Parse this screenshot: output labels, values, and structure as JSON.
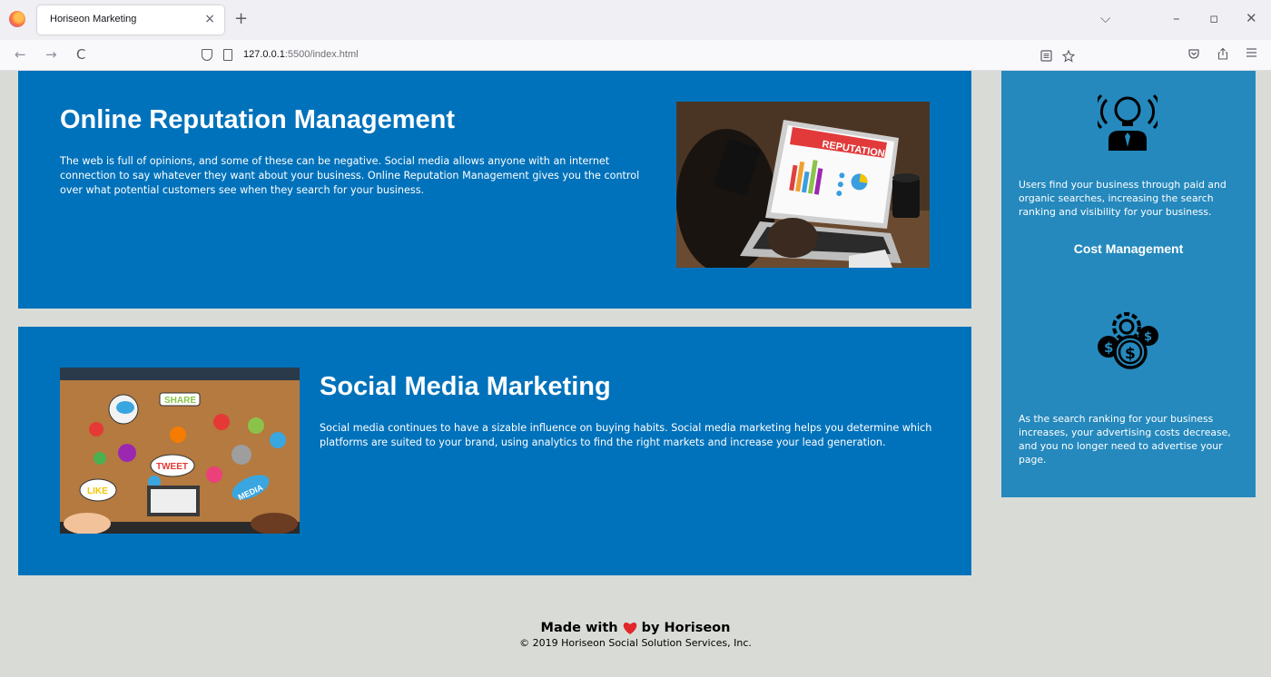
{
  "browser": {
    "tab_title": "Horiseon Marketing",
    "tab_close": "×",
    "new_tab": "+",
    "url_host": "127.0.0.1",
    "url_rest": ":5500/index.html",
    "nav_back": "←",
    "nav_forward": "→",
    "nav_reload": "C",
    "win_dropdown": "⌵",
    "win_minimize": "–",
    "win_restore": "▫",
    "win_close": "✕"
  },
  "sections": {
    "orm": {
      "title": "Online Reputation Management",
      "text": "The web is full of opinions, and some of these can be negative. Social media allows anyone with an internet connection to say whatever they want about your business. Online Reputation Management gives you the control over what potential customers see when they search for your business.",
      "image_label": "REPUTATION"
    },
    "smm": {
      "title": "Social Media Marketing",
      "text": "Social media continues to have a sizable influence on buying habits. Social media marketing helps you determine which platforms are suited to your brand, using analytics to find the right markets and increase your lead generation.",
      "image_words": [
        "SHARE",
        "TWEET",
        "LIKE",
        "MEDIA"
      ]
    }
  },
  "aside": {
    "lead_text": "Users find your business through paid and organic searches, increasing the search ranking and visibility for your business.",
    "cost_title": "Cost Management",
    "cost_text": "As the search ranking for your business increases, your advertising costs decrease, and you no longer need to advertise your page."
  },
  "footer": {
    "made_with": "Made with",
    "by": "by Horiseon",
    "copyright": "© 2019 Horiseon Social Solution Services, Inc."
  },
  "colors": {
    "card_blue": "#0072bb",
    "aside_blue": "#2589bd",
    "page_bg": "#d9dcd6",
    "heart": "#e2262b"
  }
}
